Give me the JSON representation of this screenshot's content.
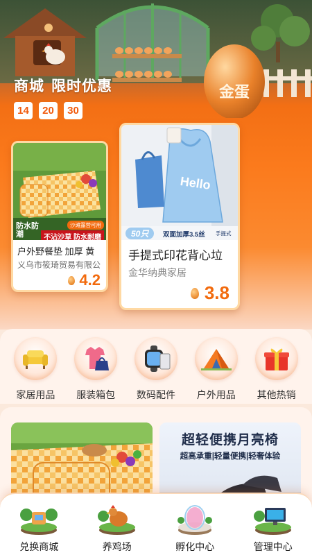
{
  "hero": {
    "title": "商城",
    "subtitle": "限时优惠",
    "countdown": [
      "14",
      "20",
      "30"
    ],
    "sign_text": "金蛋"
  },
  "products": [
    {
      "title": "户外野餐垫 加厚 黄",
      "shop": "义乌市筱琦贸易有限公",
      "price": "4.2",
      "badge_main": "防水防潮",
      "badge_top": "沙滩露营可用",
      "badge_sub": "不沾沙草 防水耐磨"
    },
    {
      "title": "手提式印花背心垃",
      "shop": "金华纳典家居",
      "price": "3.8",
      "tag_count": "50只",
      "tag_desc": "双面加厚3.5丝",
      "tag_end": "手提式",
      "bag_text": "Hello"
    }
  ],
  "categories": [
    {
      "label": "家居用品",
      "icon": "sofa-icon"
    },
    {
      "label": "服装箱包",
      "icon": "clothes-bag-icon"
    },
    {
      "label": "数码配件",
      "icon": "smartwatch-icon"
    },
    {
      "label": "户外用品",
      "icon": "tent-icon"
    },
    {
      "label": "其他热销",
      "icon": "gift-box-icon"
    }
  ],
  "promo": {
    "right_title": "超轻便携月亮椅",
    "right_subtitle": "超高承重|轻量便携|轻奢体验"
  },
  "bottom_nav": [
    {
      "label": "兑换商城",
      "icon": "shop-island-icon"
    },
    {
      "label": "养鸡场",
      "icon": "chicken-farm-icon"
    },
    {
      "label": "孵化中心",
      "icon": "incubator-icon"
    },
    {
      "label": "管理中心",
      "icon": "computer-desk-icon"
    }
  ],
  "colors": {
    "accent": "#f26a0d",
    "banner_orange": "#fb7a1c",
    "page_bg": "#fff3ec"
  }
}
